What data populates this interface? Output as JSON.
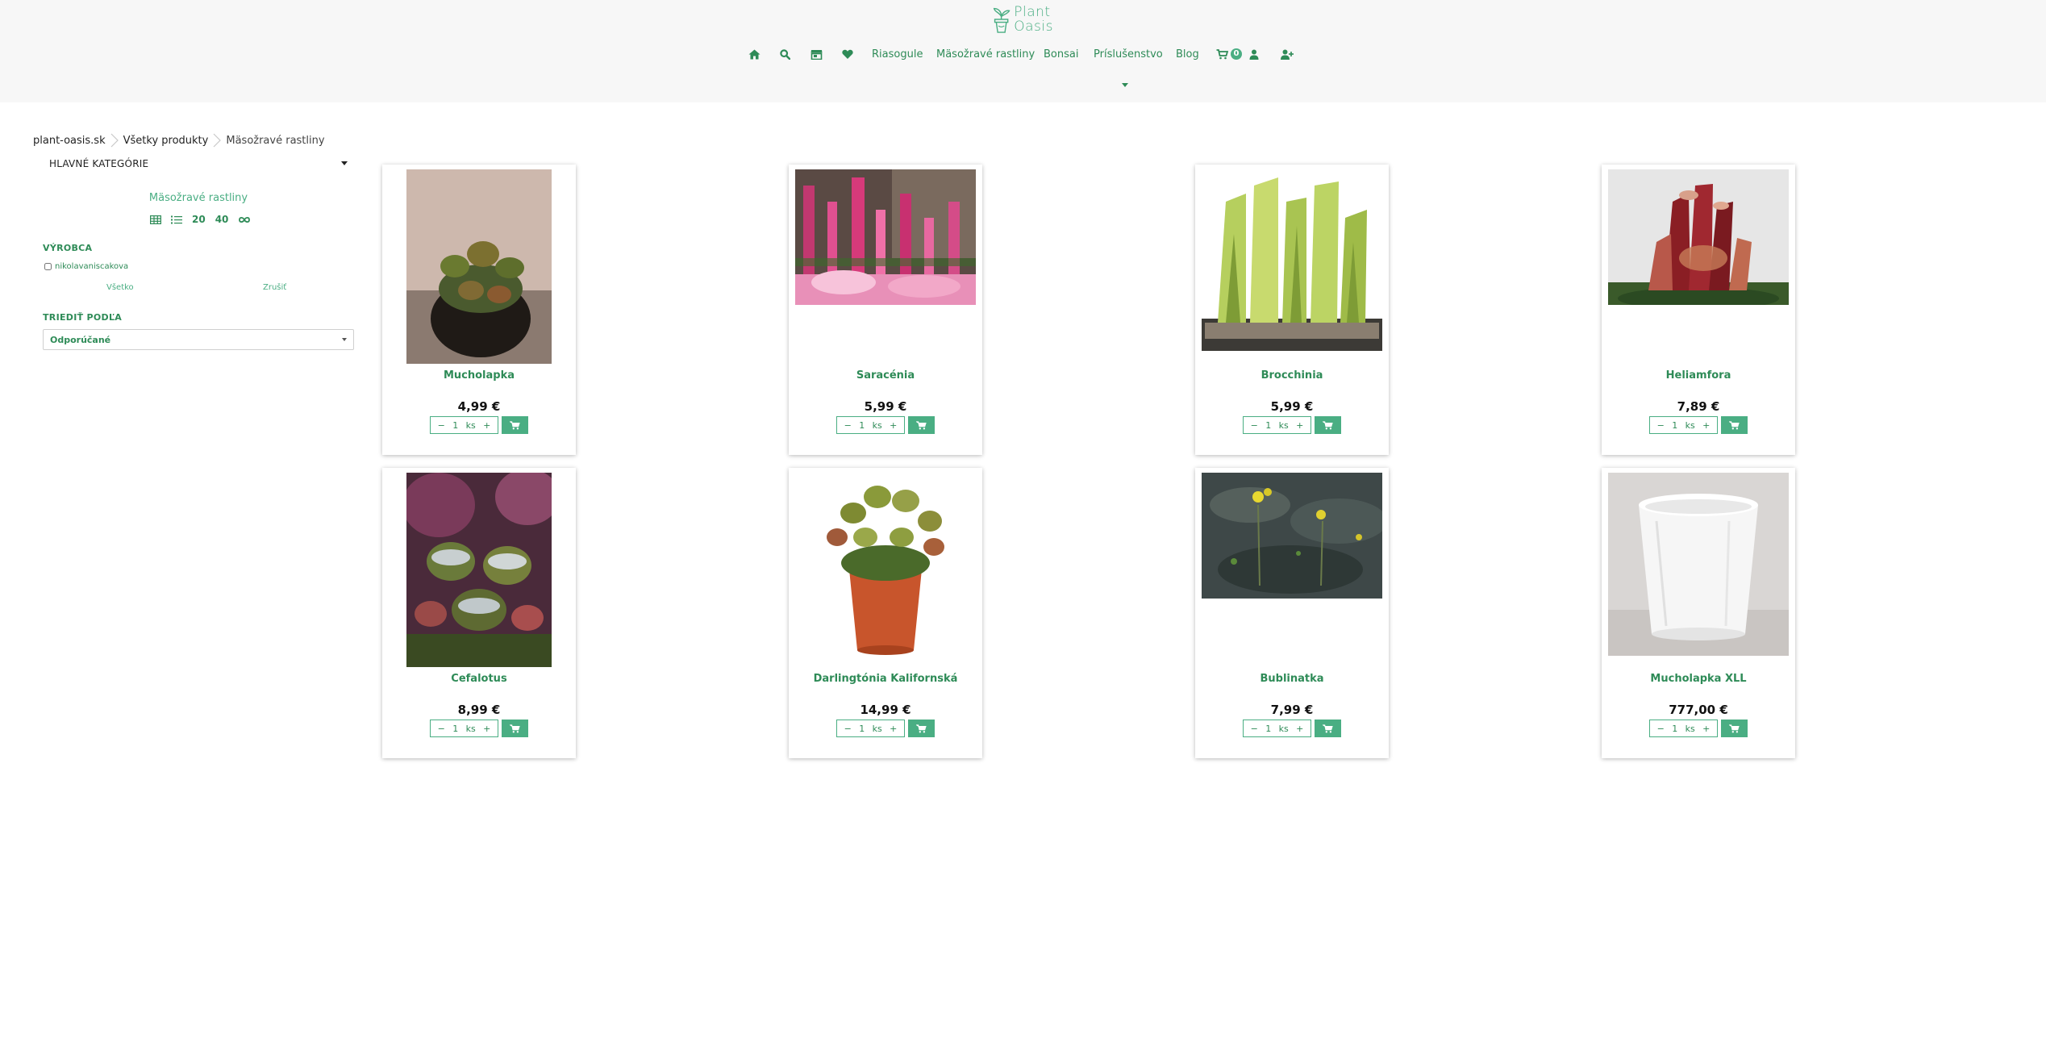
{
  "header": {
    "logo": {
      "line1": "Plant",
      "line2": "Oasis"
    },
    "nav": {
      "home_icon": "home-icon",
      "search_icon": "search-icon",
      "store_icon": "store-icon",
      "favorites_icon": "heart-icon",
      "links": [
        "Riasogule",
        "Mäsožravé rastliny",
        "Bonsai",
        "Príslušenstvo",
        "Blog"
      ],
      "cart_count": "0",
      "account_icon": "user-icon",
      "register_icon": "user-plus-icon"
    },
    "accent_color": "#4aae83",
    "link_color": "#2e8b57",
    "header_bg": "#f7f7f7"
  },
  "breadcrumb": {
    "items": [
      "plant-oasis.sk",
      "Všetky produkty",
      "Mäsožravé rastliny"
    ]
  },
  "sidebar": {
    "categories_header": "HLAVNÉ KATEGÓRIE",
    "current_category": "Mäsožravé rastliny",
    "view_options": [
      "grid",
      "list",
      "20",
      "40",
      "∞"
    ],
    "manufacturer": {
      "title": "VÝROBCA",
      "option": "nikolavaniscakova",
      "select_all": "Všetko",
      "cancel": "Zrušiť"
    },
    "sort": {
      "title": "TRIEDIŤ PODĽA",
      "selected": "Odporúčané"
    }
  },
  "products": [
    {
      "name": "Mucholapka",
      "price": "4,99 €",
      "qty": "1",
      "unit": "ks"
    },
    {
      "name": "Saracénia",
      "price": "5,99 €",
      "qty": "1",
      "unit": "ks"
    },
    {
      "name": "Brocchinia",
      "price": "5,99 €",
      "qty": "1",
      "unit": "ks"
    },
    {
      "name": "Heliamfora",
      "price": "7,89 €",
      "qty": "1",
      "unit": "ks"
    },
    {
      "name": "Cefalotus",
      "price": "8,99 €",
      "qty": "1",
      "unit": "ks"
    },
    {
      "name": "Darlingtónia Kalifornská",
      "price": "14,99 €",
      "qty": "1",
      "unit": "ks"
    },
    {
      "name": "Bublinatka",
      "price": "7,99 €",
      "qty": "1",
      "unit": "ks"
    },
    {
      "name": "Mucholapka XLL",
      "price": "777,00 €",
      "qty": "1",
      "unit": "ks"
    }
  ],
  "qty_controls": {
    "minus": "−",
    "plus": "+"
  }
}
